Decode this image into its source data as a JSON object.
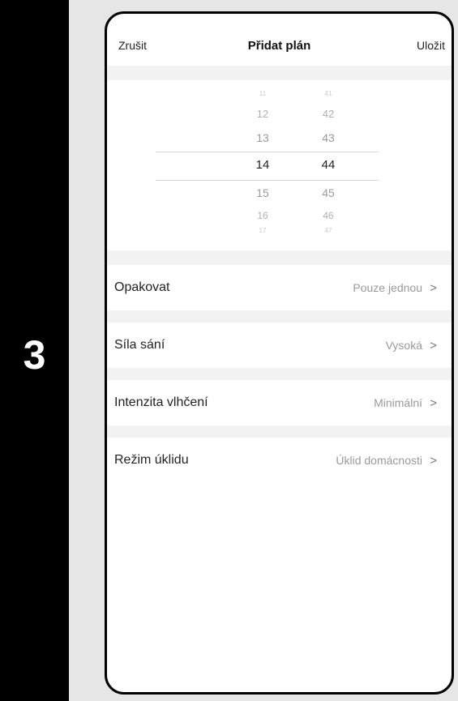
{
  "step": {
    "number": "3"
  },
  "header": {
    "cancel": "Zrušit",
    "title": "Přidat plán",
    "save": "Uložit"
  },
  "time_picker": {
    "hours": [
      "11",
      "12",
      "13",
      "14",
      "15",
      "16",
      "17"
    ],
    "minutes": [
      "41",
      "42",
      "43",
      "44",
      "45",
      "46",
      "47"
    ],
    "selected_hour": "14",
    "selected_minute": "44"
  },
  "settings": [
    {
      "label": "Opakovat",
      "value": "Pouze jednou",
      "icon": "chevron-right-icon"
    },
    {
      "label": "Síla sání",
      "value": "Vysoká",
      "icon": "chevron-right-icon"
    },
    {
      "label": "Intenzita vlhčení",
      "value": "Minimální",
      "icon": "chevron-right-icon"
    },
    {
      "label": "Režim úklidu",
      "value": "Úklid domácnosti",
      "icon": "chevron-right-icon"
    }
  ],
  "colors": {
    "step_bar": "#000000",
    "page_bg": "#e6e6e6",
    "section_gap": "#f2f2f2",
    "value_text": "#999999"
  }
}
